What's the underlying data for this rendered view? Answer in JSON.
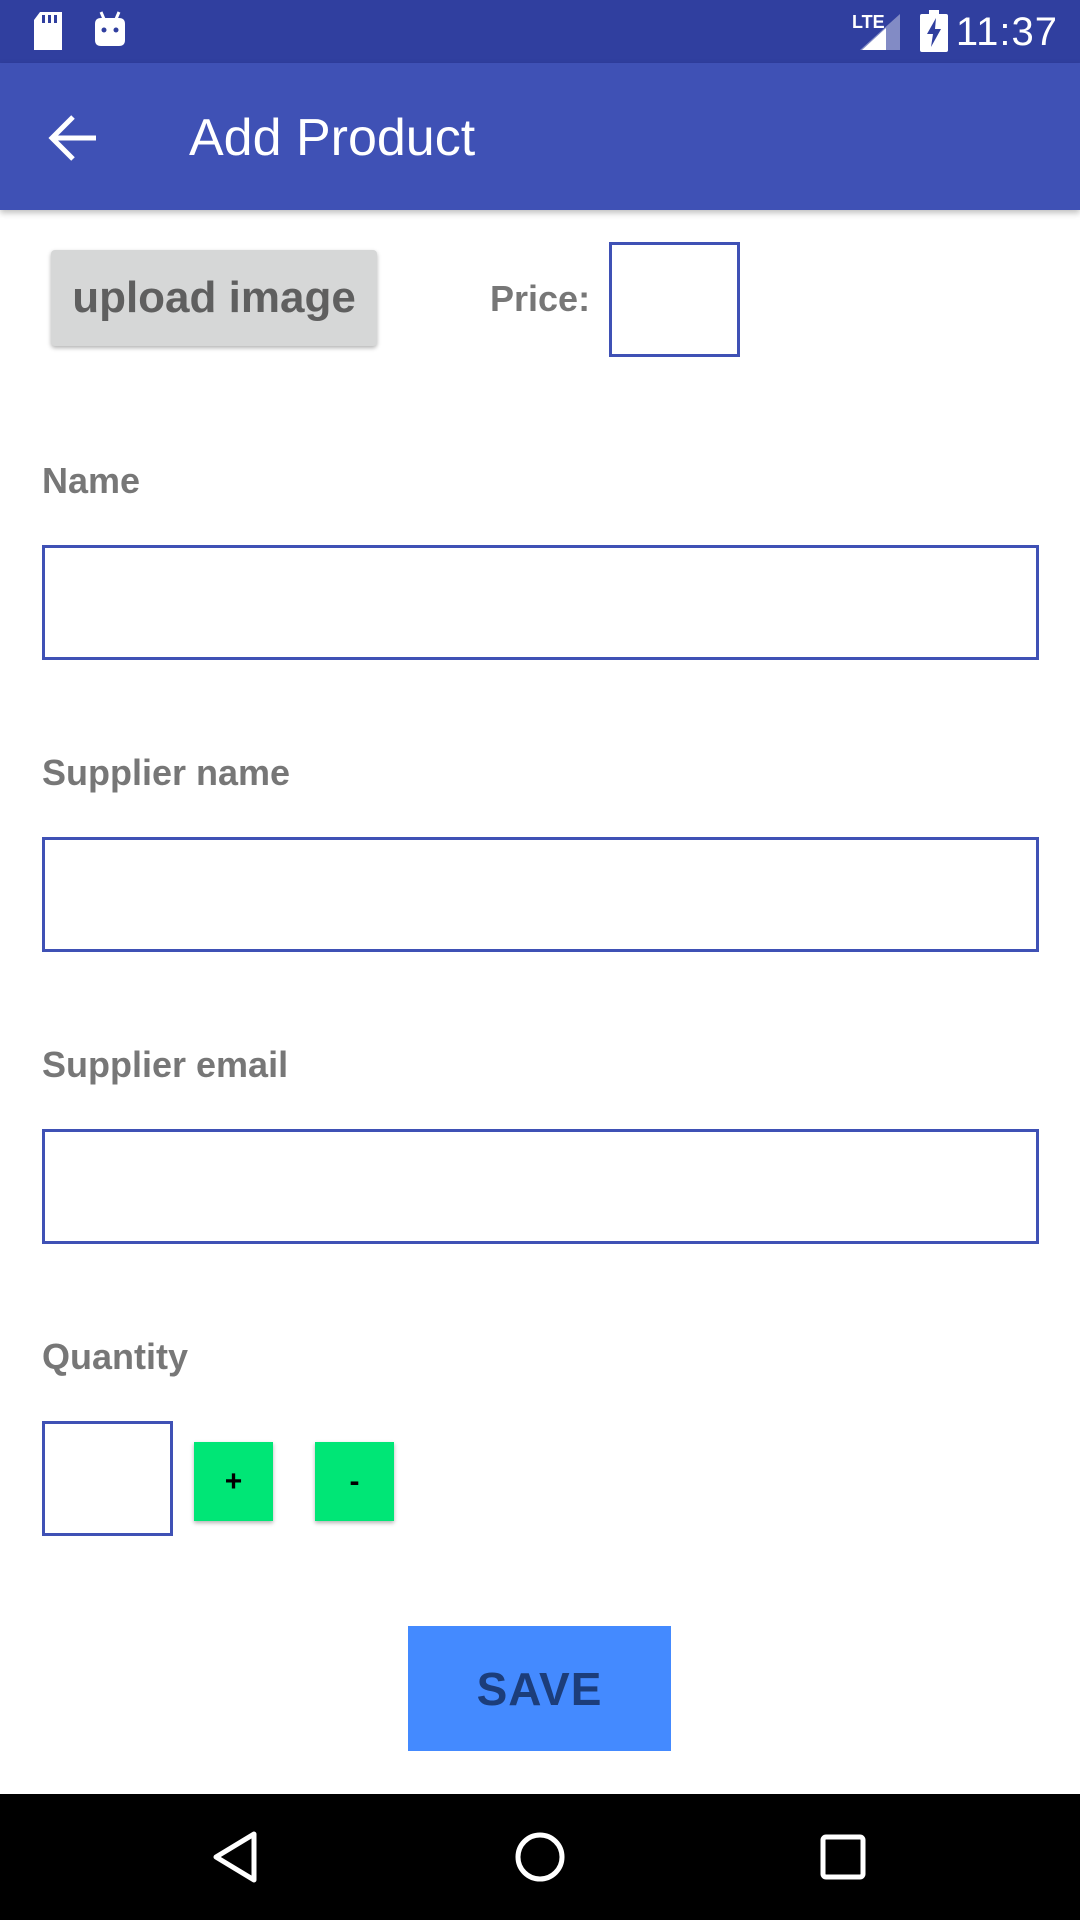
{
  "status_bar": {
    "time": "11:37",
    "network": "LTE",
    "icons": [
      "sd-card-icon",
      "android-icon",
      "lte-signal-icon",
      "battery-charging-icon"
    ]
  },
  "app_bar": {
    "title": "Add Product",
    "back_icon": "arrow-back-icon"
  },
  "form": {
    "upload_label": "upload image",
    "price_label": "Price:",
    "price_value": "",
    "name_label": "Name",
    "name_value": "",
    "supplier_name_label": "Supplier name",
    "supplier_name_value": "",
    "supplier_email_label": "Supplier email",
    "supplier_email_value": "",
    "quantity_label": "Quantity",
    "quantity_value": "",
    "increment_label": "+",
    "decrement_label": "-",
    "save_label": "SAVE"
  },
  "nav_bar": {
    "icons": [
      "back-triangle-icon",
      "home-circle-icon",
      "recents-square-icon"
    ]
  },
  "colors": {
    "status_bar": "#303f9f",
    "app_bar": "#3f51b5",
    "field_border": "#3f51b5",
    "stepper_buttons": "#00e676",
    "save_button": "#448aff"
  }
}
